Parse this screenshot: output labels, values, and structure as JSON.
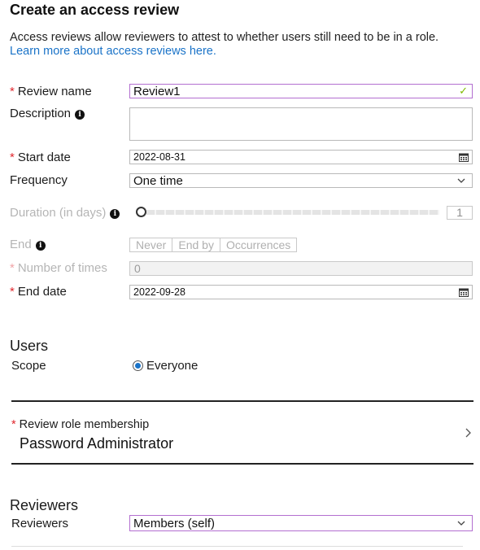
{
  "header": {
    "title": "Create an access review",
    "intro": "Access reviews allow reviewers to attest to whether users still need to be in a role.",
    "learn_more": "Learn more  about access reviews here."
  },
  "form": {
    "review_name": {
      "label": "Review name",
      "value": "Review1"
    },
    "description": {
      "label": "Description",
      "value": ""
    },
    "start_date": {
      "label": "Start date",
      "value": "2022-08-31"
    },
    "frequency": {
      "label": "Frequency",
      "value": "One time"
    },
    "duration": {
      "label": "Duration (in days)",
      "value": "1"
    },
    "end": {
      "label": "End",
      "options": [
        "Never",
        "End by",
        "Occurrences"
      ]
    },
    "number_of_times": {
      "label": "Number of times",
      "value": "0"
    },
    "end_date": {
      "label": "End date",
      "value": "2022-09-28"
    }
  },
  "users": {
    "heading": "Users",
    "scope_label": "Scope",
    "scope_value": "Everyone"
  },
  "role": {
    "label": "Review role membership",
    "value": "Password Administrator"
  },
  "reviewers": {
    "heading": "Reviewers",
    "label": "Reviewers",
    "value": "Members (self)"
  },
  "colors": {
    "link": "#1a73c8",
    "required": "#e0282e",
    "active_border": "#b36fd0",
    "valid_check": "#7fba00"
  },
  "icons": [
    "info-icon",
    "checkmark-icon",
    "calendar-icon",
    "chevron-down-icon",
    "chevron-right-icon"
  ]
}
